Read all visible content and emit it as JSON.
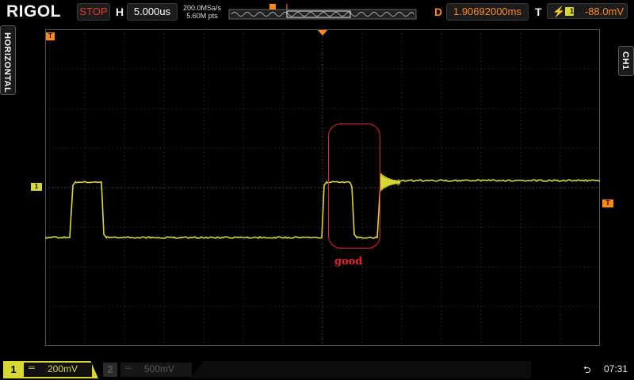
{
  "header": {
    "brand": "RIGOL",
    "run_state": "STOP",
    "horizontal_label": "H",
    "timebase": "5.000us",
    "sample_rate": "200.0MSa/s",
    "memory_depth": "5.60M pts",
    "delay_label": "D",
    "delay_value": "1.90692000ms",
    "trigger_label": "T",
    "trigger_level": "-88.0mV"
  },
  "side": {
    "left_tab": "HORIZONTAL",
    "right_tab": "CH1"
  },
  "markers": {
    "trigger_flag": "T",
    "channel_marker": "1"
  },
  "annotation": {
    "text": "good",
    "color": "#e0262b"
  },
  "footer": {
    "ch1_number": "1",
    "ch1_scale": "200mV",
    "ch2_number": "2",
    "ch2_scale": "500mV",
    "clock": "07:31"
  },
  "colors": {
    "trace": "#d8d835",
    "accent": "#ff8a1a",
    "stop": "#e23a2a"
  }
}
